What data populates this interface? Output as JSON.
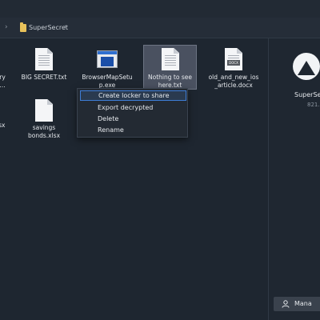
{
  "breadcrumb": {
    "folder": "SuperSecret",
    "chevron_left": "›",
    "chevron_right": "›"
  },
  "files": [
    {
      "name": "ry\n…",
      "icon": "document-icon",
      "cut": true
    },
    {
      "name": "BIG SECRET.txt",
      "icon": "text-document-icon"
    },
    {
      "name": "BrowserMapSetu\np.exe",
      "icon": "exe-icon"
    },
    {
      "name": "Nothing to see\nhere.txt",
      "icon": "text-document-icon",
      "selected": true
    },
    {
      "name": "old_and_new_ios\n_article.docx",
      "icon": "docx-icon",
      "tag": "DOCX"
    },
    {
      "name": "lsx",
      "icon": "spreadsheet-icon",
      "cut": true
    },
    {
      "name": "savings\nbonds.xlsx",
      "icon": "spreadsheet-icon"
    }
  ],
  "context_menu": {
    "items": [
      {
        "label": "Create locker to share",
        "highlighted": true
      },
      {
        "label": "Export decrypted"
      },
      {
        "label": "Delete"
      },
      {
        "label": "Rename"
      }
    ]
  },
  "side_panel": {
    "title": "SuperSe",
    "size": "821.",
    "manage_label": "Mana"
  },
  "colors": {
    "background": "#1e2630",
    "selection": "#4a5160",
    "highlight_border": "#3e7dd6",
    "folder": "#e8c15a"
  }
}
